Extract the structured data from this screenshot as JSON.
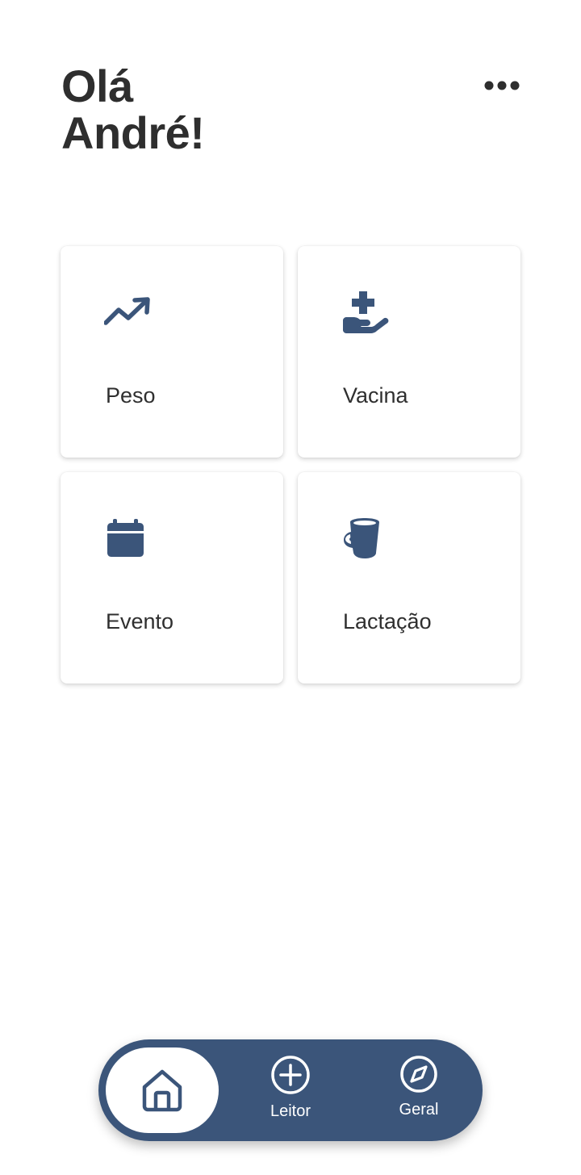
{
  "header": {
    "greeting_line1": "Olá",
    "greeting_line2": "André!",
    "menu_icon": "more-horizontal-icon"
  },
  "cards": [
    {
      "label": "Peso",
      "icon": "trending-up-icon"
    },
    {
      "label": "Vacina",
      "icon": "hand-holding-medical-icon"
    },
    {
      "label": "Evento",
      "icon": "calendar-icon"
    },
    {
      "label": "Lactação",
      "icon": "bucket-icon"
    }
  ],
  "bottom_nav": {
    "items": [
      {
        "label": "",
        "icon": "home-icon",
        "active": true
      },
      {
        "label": "Leitor",
        "icon": "plus-circle-icon"
      },
      {
        "label": "Geral",
        "icon": "compass-icon"
      }
    ]
  },
  "colors": {
    "primary": "#3b557a",
    "text": "#2e2e2e",
    "background": "#ffffff"
  }
}
